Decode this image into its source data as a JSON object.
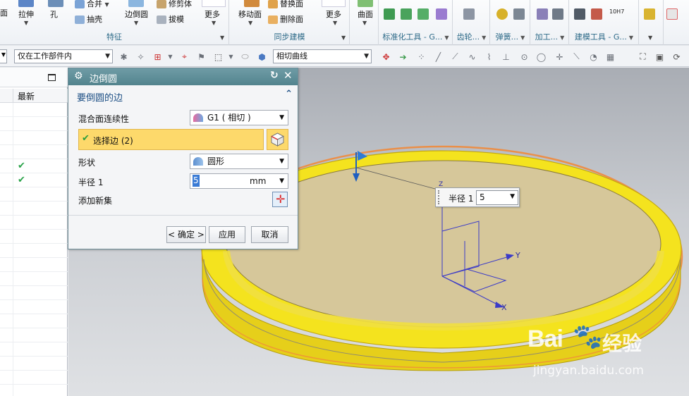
{
  "ribbon": {
    "feature_group": {
      "partial_left": "面",
      "extrude": "拉伸",
      "hole": "孔",
      "unite": "合并",
      "shell": "抽壳",
      "edge_blend": "边倒圆",
      "trim_body": "修剪体",
      "draft": "拔模",
      "more": "更多",
      "label": "特征"
    },
    "sync_group": {
      "move_face": "移动面",
      "replace_face": "替换面",
      "delete_face": "删除面",
      "more": "更多",
      "label": "同步建模"
    },
    "surface": "曲面",
    "std_tools_label": "标准化工具 - G...",
    "gear_label": "齿轮...",
    "spring_label": "弹簧...",
    "machining_label": "加工...",
    "modeling_tools_label": "建模工具 - G...",
    "partial_right_label": "",
    "fasteners_text": "10H7"
  },
  "selection_bar": {
    "scope_value": "仅在工作部件内",
    "curve_rule_value": "相切曲线"
  },
  "navigator": {
    "column_latest": "最新"
  },
  "dialog": {
    "title": "边倒圆",
    "section_title": "要倒圆的边",
    "blend_continuity_label": "混合面连续性",
    "blend_continuity_value": "G1 ( 相切 )",
    "select_edge_label": "选择边 (2)",
    "shape_label": "形状",
    "shape_value": "圆形",
    "radius_label": "半径 1",
    "radius_value": "5",
    "radius_unit": "mm",
    "add_new_set_label": "添加新集",
    "ok_button": "< 确定 >",
    "apply_button": "应用",
    "cancel_button": "取消"
  },
  "viewport": {
    "floating_radius_label": "半径 1",
    "floating_radius_value": "5",
    "axis_x": "X",
    "axis_y": "Y",
    "axis_z": "Z"
  },
  "watermark": {
    "brand": "Bai",
    "brand_suffix": "经验",
    "url": "jingyan.baidu.com"
  },
  "colors": {
    "ribbon_label": "#2d6a88",
    "dialog_title_bar": "#5a8a94",
    "selected_row": "#fdd96b",
    "part_yellow": "#f6e20f",
    "part_inner": "#d6c79a",
    "highlight_orange": "#f08a3c"
  }
}
